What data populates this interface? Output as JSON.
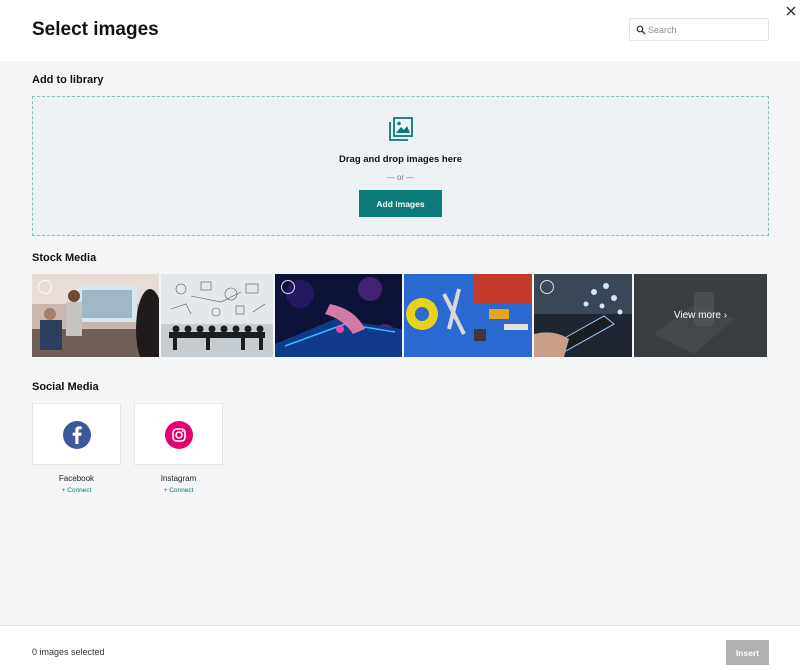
{
  "header": {
    "title": "Select images",
    "search_placeholder": "Search"
  },
  "library": {
    "section_title": "Add to library",
    "drop_text": "Drag and drop images here",
    "or_text": "— or —",
    "add_button": "Add images"
  },
  "stock": {
    "section_title": "Stock Media",
    "images": [
      {
        "subject": "business meeting"
      },
      {
        "subject": "people under sketched icons"
      },
      {
        "subject": "finger on glowing digital surface"
      },
      {
        "subject": "tools and tape"
      },
      {
        "subject": "hand holding phone with icons"
      }
    ],
    "view_more": "View more ›"
  },
  "social": {
    "section_title": "Social Media",
    "items": [
      {
        "name": "Facebook",
        "connect": "+ Connect",
        "icon": "facebook-icon",
        "color": "#3b5998"
      },
      {
        "name": "Instagram",
        "connect": "+ Connect",
        "icon": "instagram-icon",
        "color": "#e4006f"
      }
    ]
  },
  "footer": {
    "selected_text": "0 images selected",
    "insert_button": "Insert"
  },
  "colors": {
    "accent": "#0c7a76",
    "background": "#f3f5f7"
  }
}
